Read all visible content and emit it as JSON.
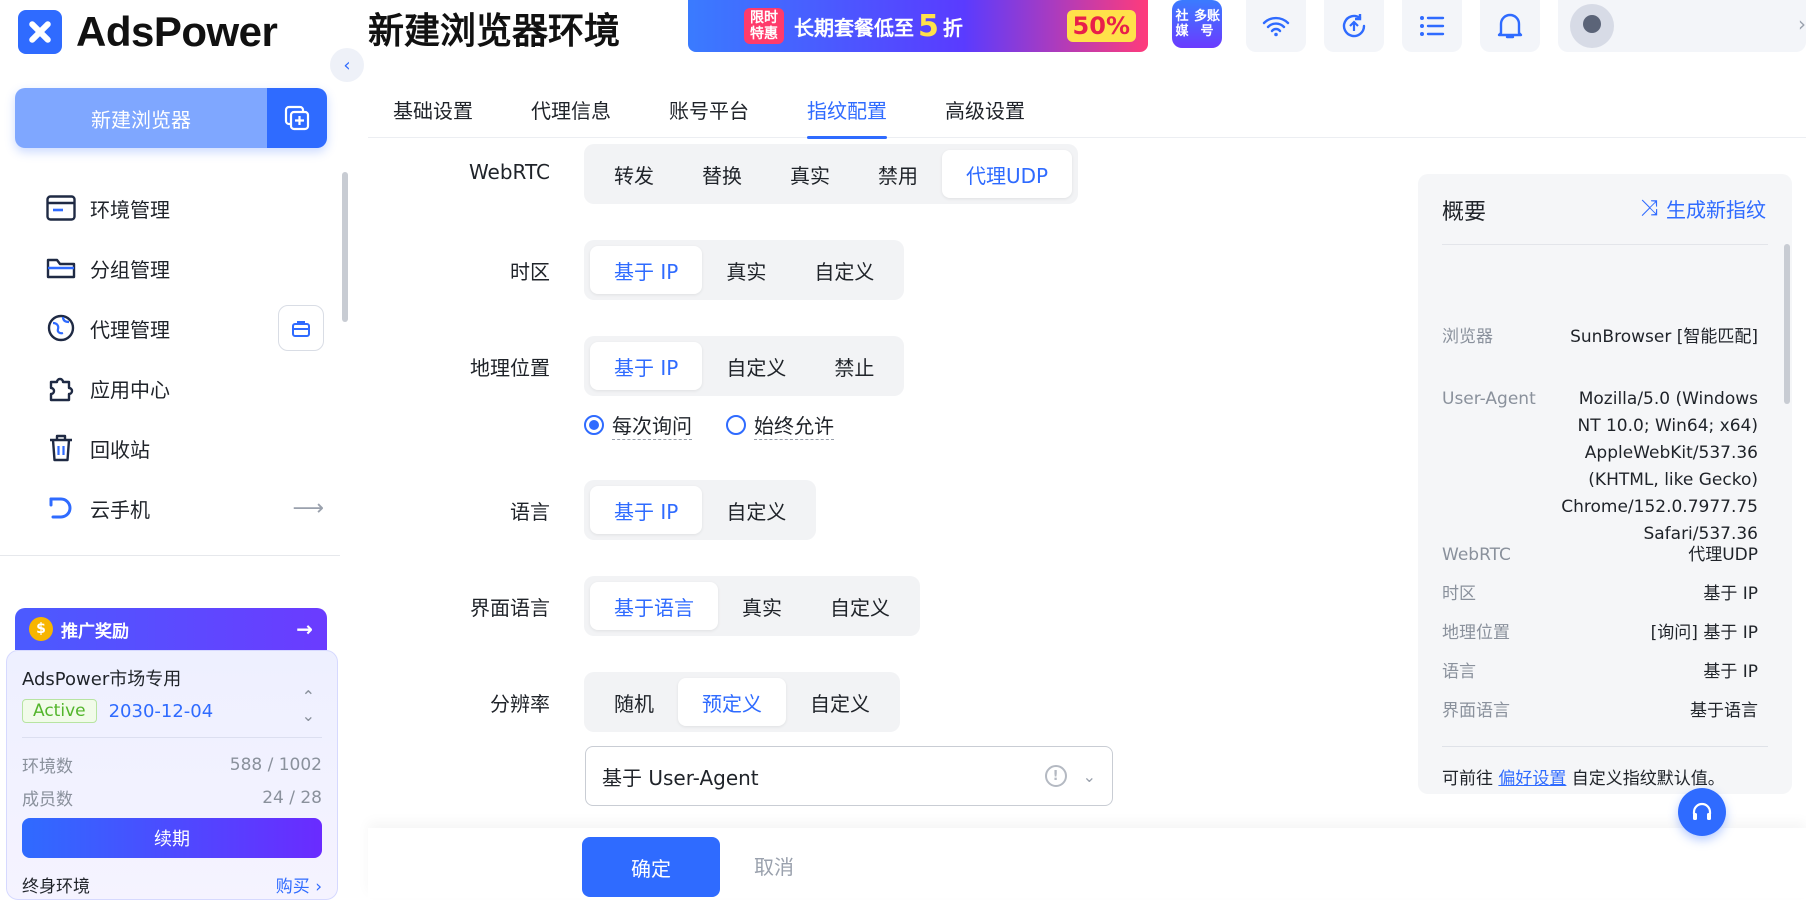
{
  "app": {
    "logo_text": "AdsPower"
  },
  "sidebar": {
    "new_browser_label": "新建浏览器",
    "items": [
      {
        "label": "环境管理",
        "icon": "window-icon"
      },
      {
        "label": "分组管理",
        "icon": "folder-icon"
      },
      {
        "label": "代理管理",
        "icon": "proxy-icon"
      },
      {
        "label": "应用中心",
        "icon": "puzzle-icon"
      },
      {
        "label": "回收站",
        "icon": "trash-icon"
      },
      {
        "label": "云手机",
        "icon": "cloud-phone-icon"
      }
    ],
    "promo": {
      "label": "推广奖励"
    },
    "plan": {
      "name": "AdsPower市场专用",
      "status": "Active",
      "expiry": "2030-12-04",
      "env_label": "环境数",
      "env_value": "588 / 1002",
      "member_label": "成员数",
      "member_value": "24 / 28",
      "renew_label": "续期",
      "lifetime_label": "终身环境",
      "buy_label": "购买 ›"
    }
  },
  "header": {
    "title": "新建浏览器环境",
    "banner": {
      "tag_line1": "限时",
      "tag_line2": "特惠",
      "text": "长期套餐低至",
      "highlight": "5",
      "unit": "折",
      "pct": "50%"
    },
    "social_line1": "社媒",
    "social_line2": "多账号"
  },
  "tabs": [
    "基础设置",
    "代理信息",
    "账号平台",
    "指纹配置",
    "高级设置"
  ],
  "active_tab": "指纹配置",
  "form": {
    "webrtc": {
      "label": "WebRTC",
      "options": [
        "转发",
        "替换",
        "真实",
        "禁用",
        "代理UDP"
      ],
      "selected": "代理UDP"
    },
    "timezone": {
      "label": "时区",
      "options": [
        "基于 IP",
        "真实",
        "自定义"
      ],
      "selected": "基于 IP"
    },
    "geolocation": {
      "label": "地理位置",
      "options": [
        "基于 IP",
        "自定义",
        "禁止"
      ],
      "selected": "基于 IP",
      "radios": [
        "每次询问",
        "始终允许"
      ],
      "radio_selected": "每次询问"
    },
    "language": {
      "label": "语言",
      "options": [
        "基于 IP",
        "自定义"
      ],
      "selected": "基于 IP"
    },
    "ui_language": {
      "label": "界面语言",
      "options": [
        "基于语言",
        "真实",
        "自定义"
      ],
      "selected": "基于语言"
    },
    "resolution": {
      "label": "分辨率",
      "options": [
        "随机",
        "预定义",
        "自定义"
      ],
      "selected": "预定义",
      "select_value": "基于 User-Agent"
    }
  },
  "actions": {
    "ok": "确定",
    "cancel": "取消"
  },
  "summary": {
    "title": "概要",
    "generate_label": "生成新指纹",
    "rows": [
      {
        "k": "浏览器",
        "v": "SunBrowser [智能匹配]"
      },
      {
        "k": "User-Agent",
        "v": "Mozilla/5.0 (Windows NT 10.0; Win64; x64) AppleWebKit/537.36 (KHTML, like Gecko) Chrome/152.0.7977.75 Safari/537.36"
      },
      {
        "k": "WebRTC",
        "v": "代理UDP"
      },
      {
        "k": "时区",
        "v": "基于 IP"
      },
      {
        "k": "地理位置",
        "v": "[询问] 基于 IP"
      },
      {
        "k": "语言",
        "v": "基于 IP"
      },
      {
        "k": "界面语言",
        "v": "基于语言"
      }
    ],
    "note_prefix": "可前往 ",
    "note_link": "偏好设置",
    "note_suffix": " 自定义指纹默认值。"
  },
  "colors": {
    "accent": "#2f6bff",
    "active_badge": "#52b52b"
  }
}
